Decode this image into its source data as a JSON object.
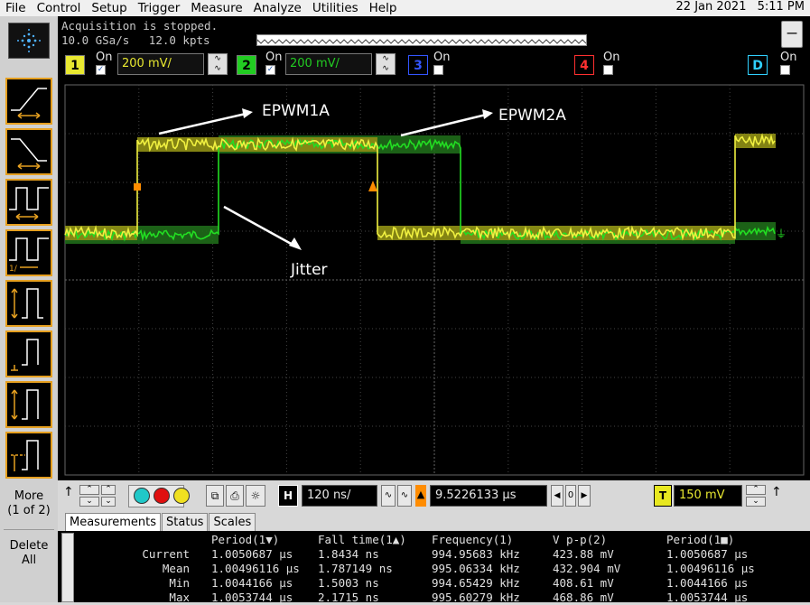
{
  "menu": {
    "items": [
      "File",
      "Control",
      "Setup",
      "Trigger",
      "Measure",
      "Analyze",
      "Utilities",
      "Help"
    ],
    "date": "22 Jan 2021",
    "time": "5:11 PM"
  },
  "status": {
    "acquisition": "Acquisition is stopped.",
    "sample_rate": "10.0 GSa/s",
    "record_length": "12.0 kpts",
    "minimize_label": "—"
  },
  "channels": [
    {
      "num": "1",
      "on_label": "On",
      "checked": true,
      "scale": "200 mV/",
      "color": "#e8e830"
    },
    {
      "num": "2",
      "on_label": "On",
      "checked": true,
      "scale": "200 mV/",
      "color": "#22cc22"
    },
    {
      "num": "3",
      "on_label": "On",
      "checked": false,
      "color": "#3355ff"
    },
    {
      "num": "4",
      "on_label": "On",
      "checked": false,
      "color": "#ff3030"
    },
    {
      "num": "D",
      "on_label": "On",
      "checked": false,
      "color": "#30d0ff"
    }
  ],
  "annotations": {
    "epwm1a": "EPWM1A",
    "epwm2a": "EPWM2A",
    "jitter": "Jitter"
  },
  "sidebar": {
    "more_label": "More",
    "more_page": "(1 of 2)",
    "delete_label": "Delete",
    "delete_all": "All"
  },
  "controls": {
    "horizontal_label": "H",
    "horizontal_scale": "120 ns/",
    "delay": "9.5226133 µs",
    "trigger_label": "T",
    "trigger_level": "150 mV"
  },
  "tabs": [
    "Measurements",
    "Status",
    "Scales"
  ],
  "measurements": {
    "row_labels": [
      "",
      "Current",
      "Mean",
      "Min",
      "Max"
    ],
    "columns": [
      {
        "header": "Period(1▼)",
        "values": [
          "1.0050687 µs",
          "1.00496116 µs",
          "1.0044166 µs",
          "1.0053744 µs"
        ]
      },
      {
        "header": "Fall time(1▲)",
        "values": [
          "1.8434 ns",
          "1.787149 ns",
          "1.5003 ns",
          "2.1715 ns"
        ]
      },
      {
        "header": "Frequency(1)",
        "values": [
          "994.95683 kHz",
          "995.06334 kHz",
          "994.65429 kHz",
          "995.60279 kHz"
        ]
      },
      {
        "header": "V p-p(2)",
        "values": [
          "423.88 mV",
          "432.904 mV",
          "408.61 mV",
          "468.86 mV"
        ]
      },
      {
        "header": "Period(1■)",
        "values": [
          "1.0050687 µs",
          "1.00496116 µs",
          "1.0044166 µs",
          "1.0053744 µs"
        ]
      }
    ]
  },
  "colors": {
    "ch1": "#e8e830",
    "ch2": "#22cc22",
    "marker": "#ff8c00",
    "grid": "#555555"
  }
}
